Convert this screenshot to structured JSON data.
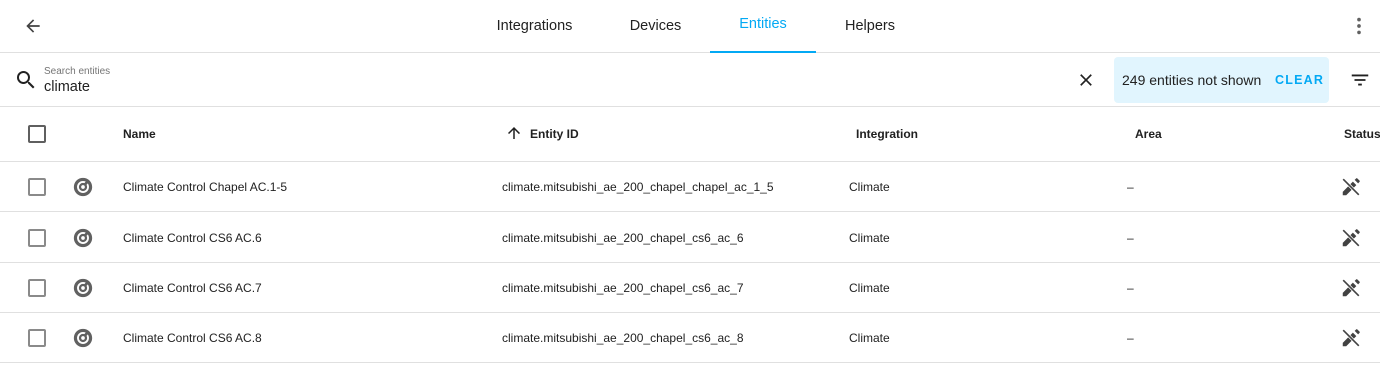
{
  "header": {
    "back_icon": "arrow-left-icon",
    "tabs": [
      {
        "label": "Integrations",
        "active": false
      },
      {
        "label": "Devices",
        "active": false
      },
      {
        "label": "Entities",
        "active": true
      },
      {
        "label": "Helpers",
        "active": false
      }
    ],
    "more_icon": "dots-vertical-icon"
  },
  "search": {
    "label": "Search entities",
    "value": "climate",
    "hidden_notice": "249 entities not shown",
    "clear_label": "CLEAR"
  },
  "table": {
    "columns": {
      "name": "Name",
      "entity_id": "Entity ID",
      "integration": "Integration",
      "area": "Area",
      "status": "Status"
    },
    "sort": {
      "column": "entity_id",
      "direction": "ascending"
    },
    "rows": [
      {
        "name": "Climate Control Chapel AC.1-5",
        "entity_id": "climate.mitsubishi_ae_200_chapel_chapel_ac_1_5",
        "integration": "Climate",
        "area": "–",
        "status_icon": "pencil-off-icon"
      },
      {
        "name": "Climate Control CS6 AC.6",
        "entity_id": "climate.mitsubishi_ae_200_chapel_cs6_ac_6",
        "integration": "Climate",
        "area": "–",
        "status_icon": "pencil-off-icon"
      },
      {
        "name": "Climate Control CS6 AC.7",
        "entity_id": "climate.mitsubishi_ae_200_chapel_cs6_ac_7",
        "integration": "Climate",
        "area": "–",
        "status_icon": "pencil-off-icon"
      },
      {
        "name": "Climate Control CS6 AC.8",
        "entity_id": "climate.mitsubishi_ae_200_chapel_cs6_ac_8",
        "integration": "Climate",
        "area": "–",
        "status_icon": "pencil-off-icon"
      }
    ]
  },
  "colors": {
    "accent": "#03a9f4",
    "notice_bg": "#e1f5fe",
    "icon": "#616161",
    "divider": "#e0e0e0"
  }
}
